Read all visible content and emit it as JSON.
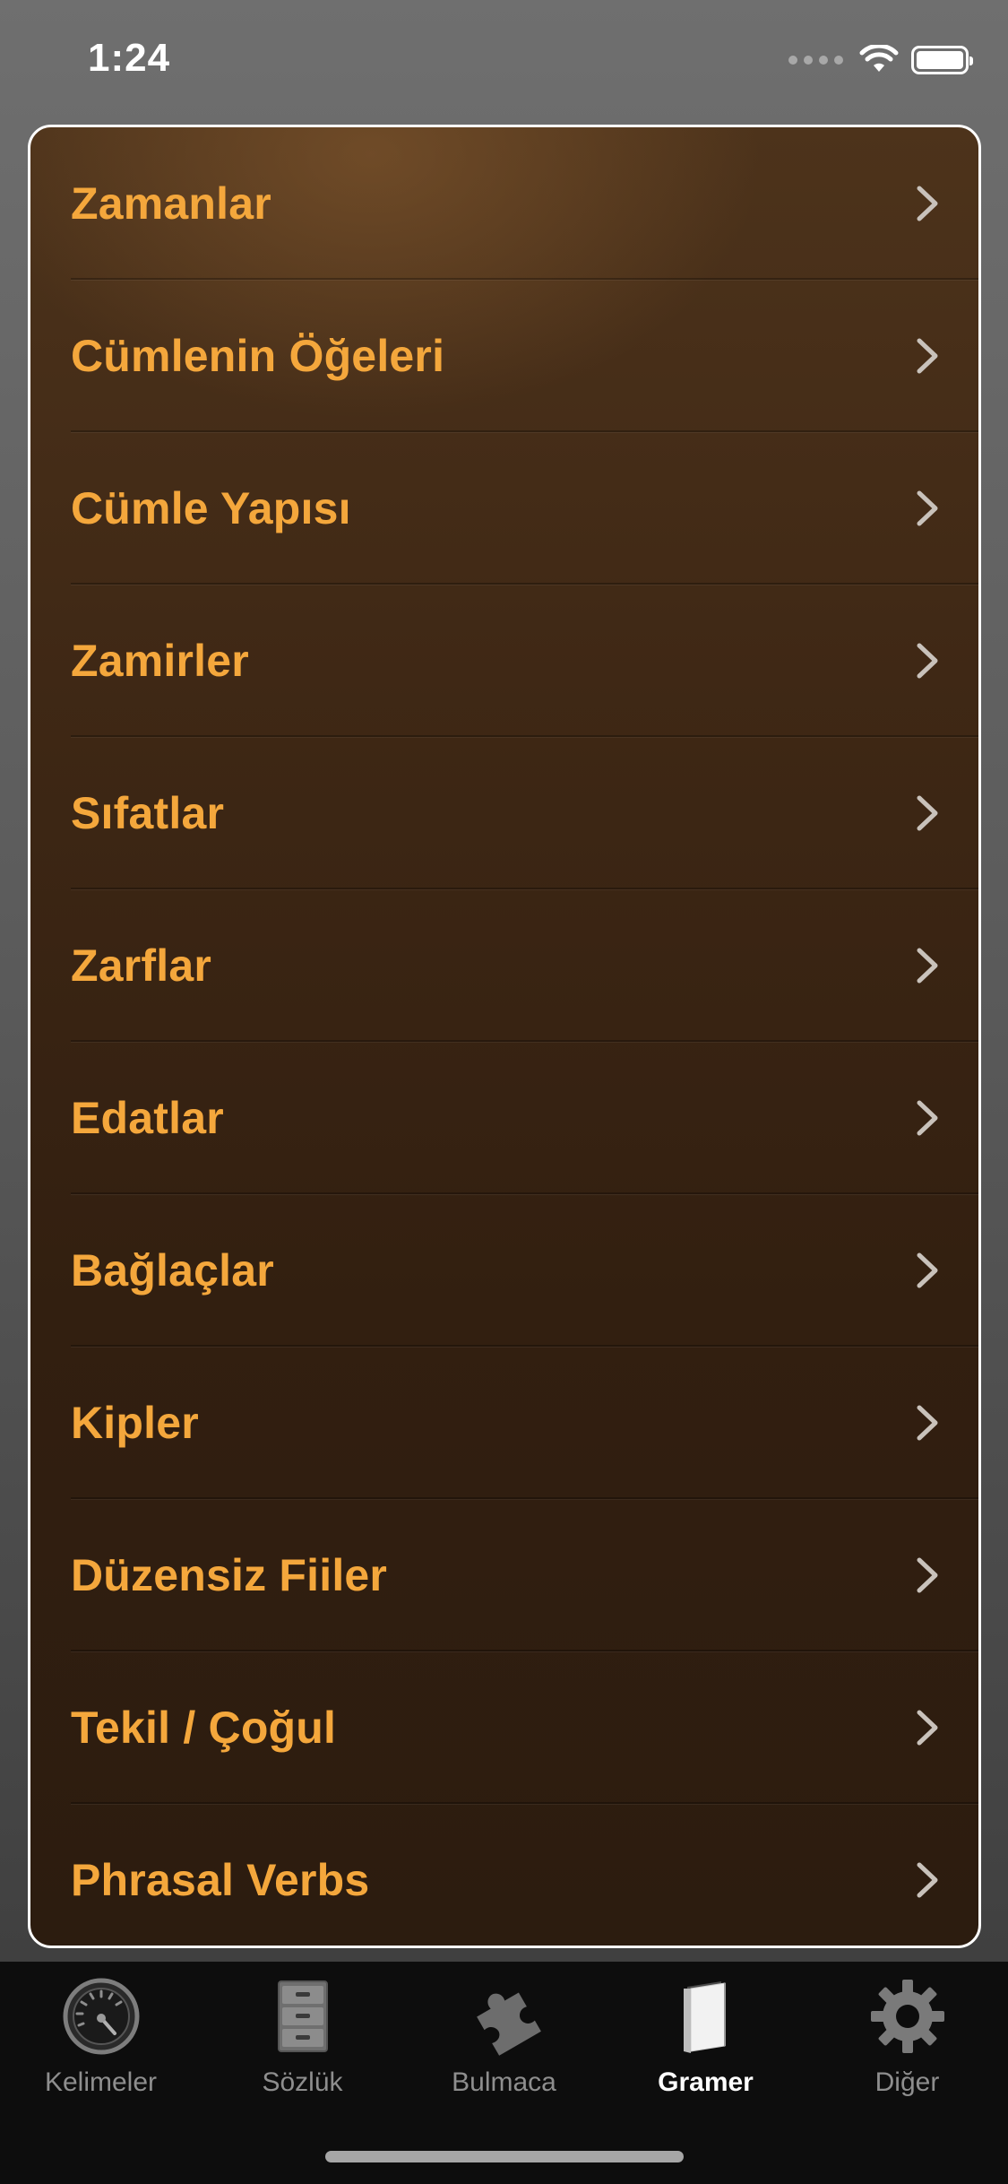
{
  "status_bar": {
    "time": "1:24"
  },
  "menu": {
    "items": [
      {
        "label": "Zamanlar"
      },
      {
        "label": "Cümlenin Öğeleri"
      },
      {
        "label": "Cümle Yapısı"
      },
      {
        "label": "Zamirler"
      },
      {
        "label": "Sıfatlar"
      },
      {
        "label": "Zarflar"
      },
      {
        "label": "Edatlar"
      },
      {
        "label": "Bağlaçlar"
      },
      {
        "label": "Kipler"
      },
      {
        "label": "Düzensiz Fiiler"
      },
      {
        "label": "Tekil / Çoğul"
      },
      {
        "label": "Phrasal Verbs"
      }
    ]
  },
  "tab_bar": {
    "tabs": [
      {
        "label": "Kelimeler",
        "icon": "speedometer-icon",
        "active": false
      },
      {
        "label": "Sözlük",
        "icon": "file-cabinet-icon",
        "active": false
      },
      {
        "label": "Bulmaca",
        "icon": "puzzle-piece-icon",
        "active": false
      },
      {
        "label": "Gramer",
        "icon": "book-icon",
        "active": true
      },
      {
        "label": "Diğer",
        "icon": "gear-icon",
        "active": false
      }
    ]
  },
  "colors": {
    "item_text": "#f4a73c",
    "panel_bg": "#3f2815",
    "tab_active": "#ffffff",
    "tab_inactive": "#8e8e8e"
  }
}
